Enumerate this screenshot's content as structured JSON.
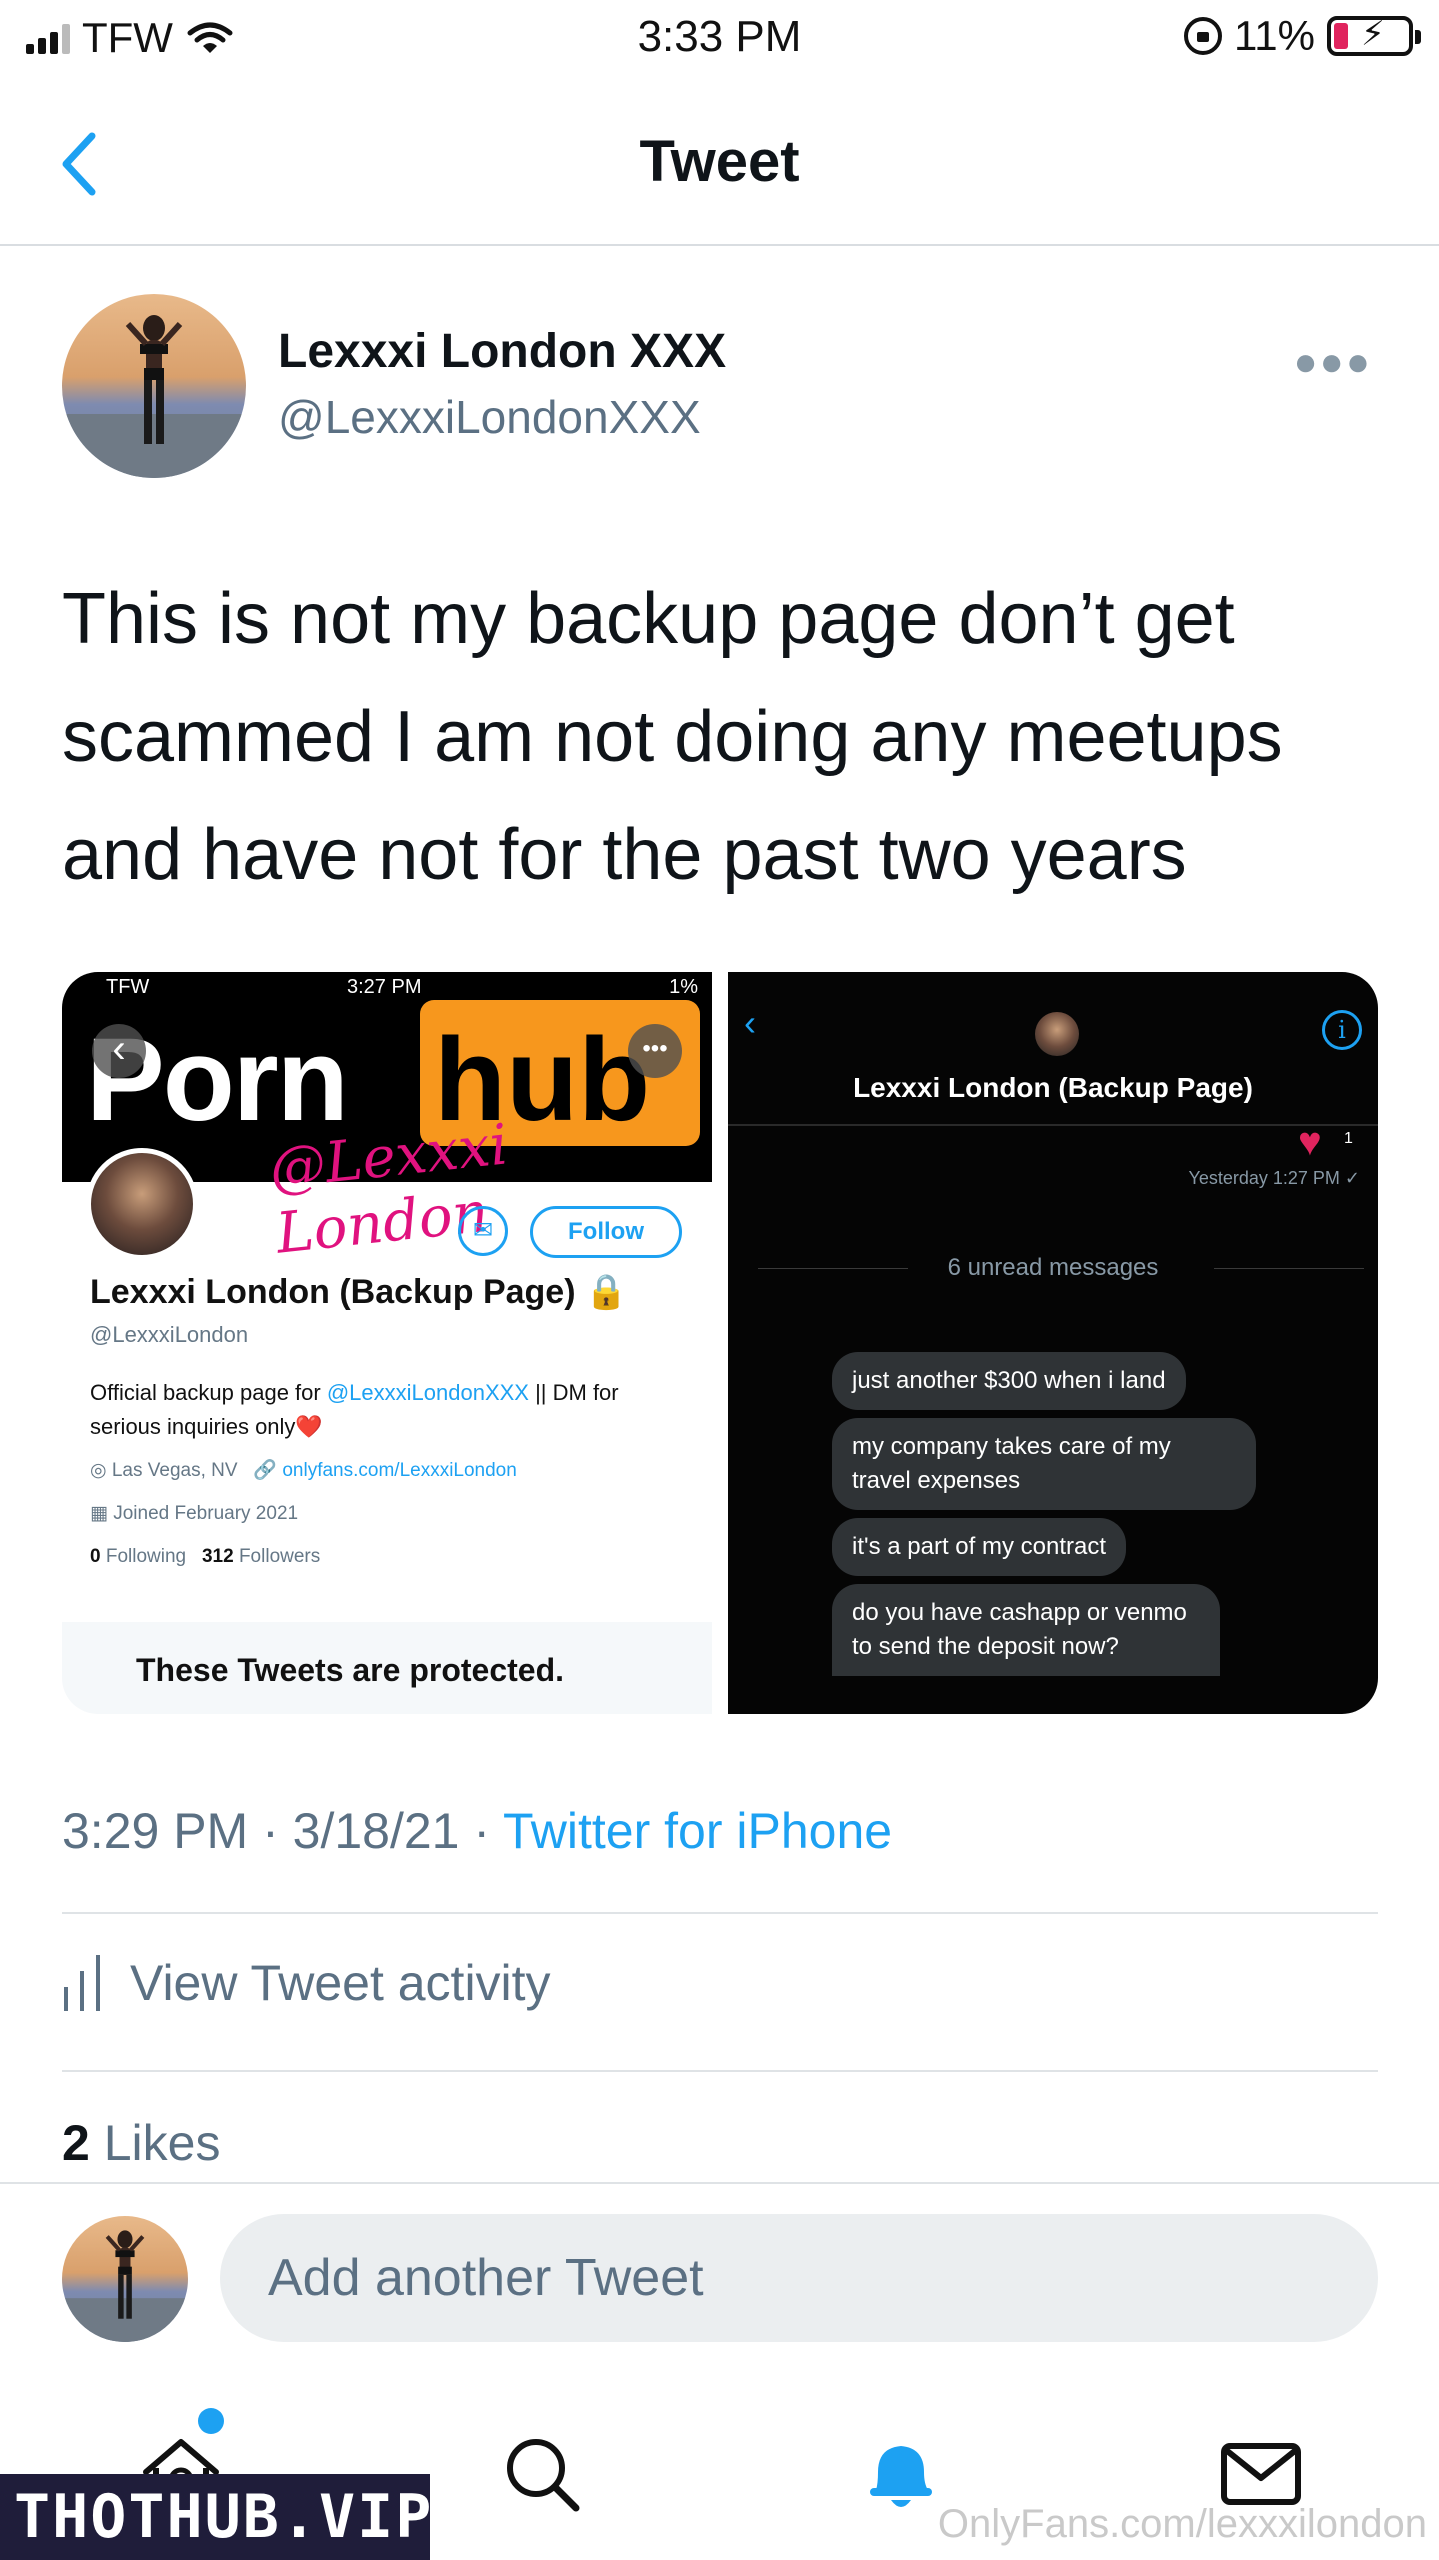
{
  "status_bar": {
    "carrier": "TFW",
    "time": "3:33 PM",
    "battery": "11%"
  },
  "nav": {
    "title": "Tweet"
  },
  "tweet": {
    "author_name": "Lexxxi London XXX",
    "author_handle": "@LexxxiLondonXXX",
    "text": "This is not my backup page don’t get scammed I am not doing any meetups and have not for the past two years",
    "time": "3:29 PM",
    "date": "3/18/21",
    "source": "Twitter for iPhone",
    "activity_label": "View Tweet activity",
    "likes_count": "2",
    "likes_label": "Likes"
  },
  "media_left": {
    "status_carrier": "TFW",
    "status_time": "3:27 PM",
    "status_battery": "1%",
    "banner_left": "Porn",
    "banner_right": "hub",
    "banner_script": "@Lexxxi London",
    "follow_label": "Follow",
    "profile_name": "Lexxxi London (Backup Page) 🔒",
    "profile_handle": "@LexxxiLondon",
    "bio_prefix": "Official backup page for ",
    "bio_mention": "@LexxxiLondonXXX",
    "bio_suffix": " || DM for serious inquiries only❤️",
    "location": "Las Vegas, NV",
    "website": "onlyfans.com/LexxxiLondon",
    "joined": "Joined February 2021",
    "following_count": "0",
    "following_label": "Following",
    "followers_count": "312",
    "followers_label": "Followers",
    "protected_text": "These Tweets are protected."
  },
  "media_right": {
    "title": "Lexxxi London (Backup Page)",
    "reaction_count": "1",
    "timestamp": "Yesterday 1:27 PM ✓",
    "unread": "6 unread messages",
    "messages": [
      "just another $300 when i land",
      "my company takes care of my travel expenses",
      "it's a part of my contract",
      "do you have cashapp or venmo to send the deposit now?"
    ]
  },
  "reply": {
    "placeholder": "Add another Tweet"
  },
  "watermarks": {
    "left": "THOTHUB.VIP",
    "right": "OnlyFans.com/lexxxilondon"
  },
  "colors": {
    "accent": "#1da1f2",
    "muted": "#5b7083",
    "text": "#0f1419"
  },
  "icons": [
    "back-chevron-icon",
    "more-icon",
    "activity-icon",
    "home-icon",
    "search-icon",
    "bell-icon",
    "mail-icon"
  ]
}
